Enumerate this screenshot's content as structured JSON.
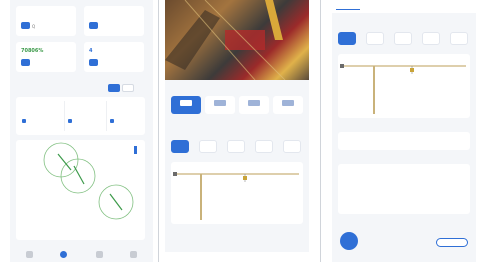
{
  "panel1": {
    "stats": [
      {
        "value": "",
        "label": "Q"
      },
      {
        "value": "",
        "label": ""
      },
      {
        "value": "70806%",
        "label": ""
      },
      {
        "value": "4",
        "label": ""
      }
    ],
    "section_title": "",
    "filters": [
      "",
      "",
      ""
    ],
    "legend": [
      "",
      ""
    ]
  },
  "panel2": {
    "section1_title": "",
    "controls": [
      "",
      "",
      "",
      ""
    ],
    "section2_title": "",
    "chips": [
      "",
      "",
      "",
      "",
      ""
    ],
    "section3_title": "",
    "bottom_labels": [
      "",
      ""
    ]
  },
  "panel3": {
    "tabs": [
      "",
      "",
      "",
      ""
    ],
    "section_title": "",
    "chips": [
      "",
      "",
      "",
      "",
      ""
    ],
    "subsection_title": "",
    "row_items": [
      "",
      ""
    ],
    "grid_title": "",
    "grid_items": [
      "",
      "",
      "",
      "",
      "",
      "",
      ""
    ],
    "footer_title": "",
    "footer_button": ""
  },
  "bottom_nav": [
    "",
    "",
    "",
    ""
  ],
  "colors": {
    "accent": "#2f6fd6",
    "crane": "#c9b27a",
    "green": "#3c9a4a",
    "red": "#d24a4a"
  },
  "icons": [
    "stats-icon",
    "filter-icon",
    "crane-icon",
    "camera-icon",
    "home-icon",
    "user-icon"
  ]
}
